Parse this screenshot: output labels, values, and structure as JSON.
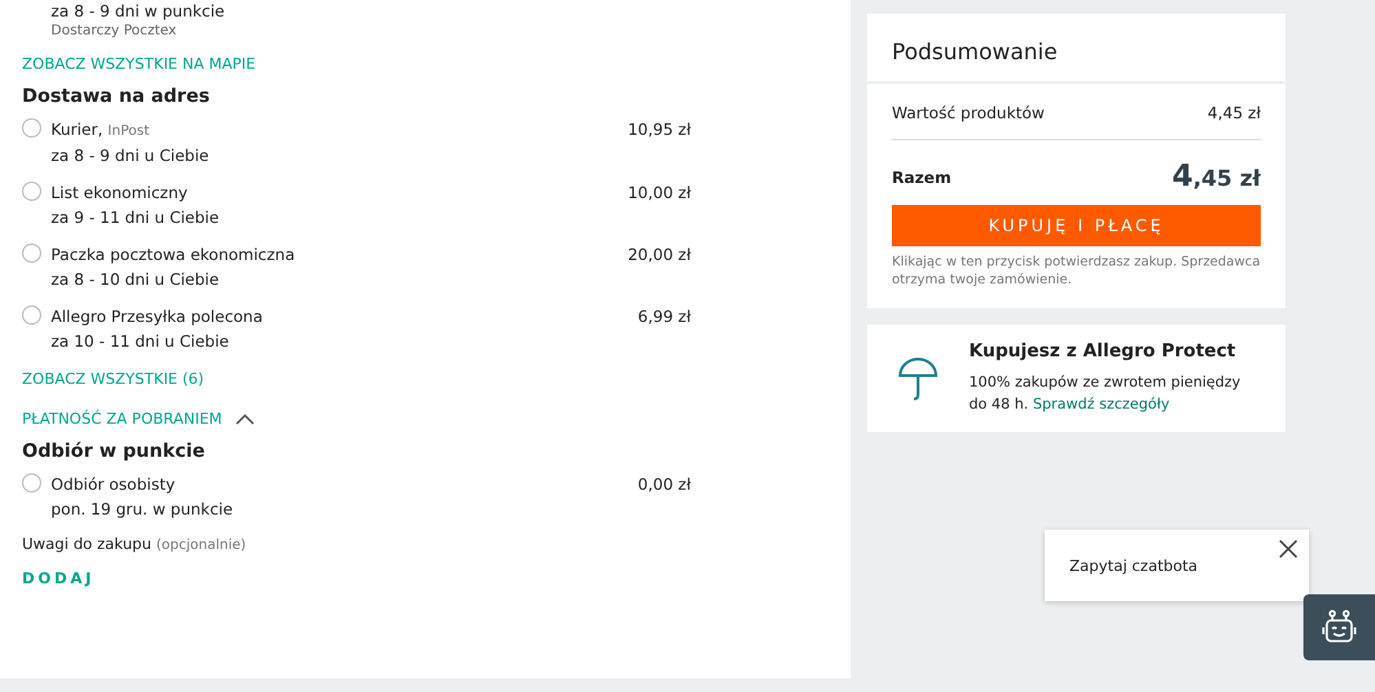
{
  "pickup_tail": {
    "eta": "za 8 - 9 dni w punkcie",
    "carrier": "Dostarczy Pocztex"
  },
  "map_link": "ZOBACZ WSZYSTKIE NA MAPIE",
  "address_section": {
    "title": "Dostawa na adres",
    "options": [
      {
        "name": "Kurier,",
        "carrier": "InPost",
        "eta": "za 8 - 9 dni u Ciebie",
        "price": "10,95 zł",
        "selected": false
      },
      {
        "name": "List ekonomiczny",
        "eta": "za 9 - 11 dni u Ciebie",
        "price": "10,00 zł",
        "selected": false
      },
      {
        "name": "Paczka pocztowa ekonomiczna",
        "eta": "za 8 - 10 dni u Ciebie",
        "price": "20,00 zł",
        "selected": false
      },
      {
        "name": "Allegro Przesyłka polecona",
        "eta": "za 10 - 11 dni u Ciebie",
        "price": "6,99 zł",
        "selected": false
      }
    ]
  },
  "show_all_link": "ZOBACZ WSZYSTKIE (6)",
  "cod_toggle": {
    "label": "PŁATNOŚĆ ZA POBRANIEM",
    "expanded": true
  },
  "pickup_section": {
    "title": "Odbiór w punkcie",
    "options": [
      {
        "name": "Odbiór osobisty",
        "eta": "pon. 19 gru. w punkcie",
        "price": "0,00 zł",
        "selected": false
      }
    ]
  },
  "notes": {
    "label": "Uwagi do zakupu",
    "hint": "(opcjonalnie)",
    "action": "DODAJ"
  },
  "summary": {
    "title": "Podsumowanie",
    "products_label": "Wartość produktów",
    "products_value": "4,45 zł",
    "total_label": "Razem",
    "total_main": "4",
    "total_rest": ",45 zł",
    "buy_button": "KUPUJĘ I PŁACĘ",
    "disclaimer": "Klikając w ten przycisk potwierdzasz zakup. Sprzedawca otrzyma twoje zamówienie."
  },
  "protect": {
    "title": "Kupujesz z Allegro Protect",
    "text": "100% zakupów ze zwrotem pieniędzy do 48 h.",
    "link": "Sprawdź szczegóły"
  },
  "chat": {
    "prompt": "Zapytaj czatbota"
  }
}
